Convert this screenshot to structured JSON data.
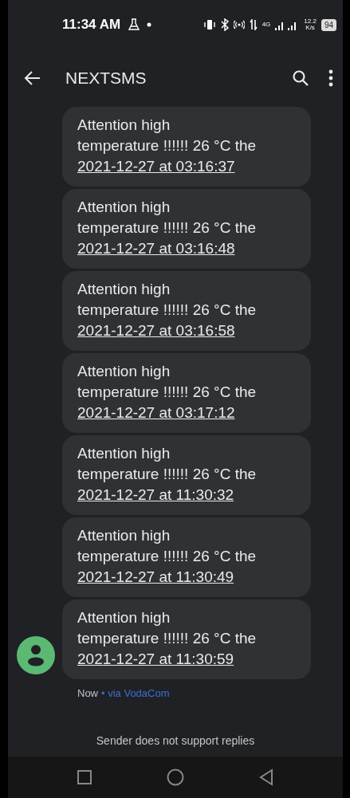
{
  "status_bar": {
    "time": "11:34 AM",
    "network": "4G",
    "speed": "12.2",
    "speed_unit": "K/s",
    "battery": "94"
  },
  "app_bar": {
    "title": "NEXTSMS"
  },
  "messages": [
    {
      "lines": [
        "Attention high",
        "temperature !!!!!! 26 °C the"
      ],
      "link": "2021-12-27 at 03:16:37"
    },
    {
      "lines": [
        "Attention high",
        "temperature !!!!!! 26 °C the"
      ],
      "link": "2021-12-27 at 03:16:48"
    },
    {
      "lines": [
        "Attention high",
        "temperature !!!!!! 26 °C the"
      ],
      "link": "2021-12-27 at 03:16:58"
    },
    {
      "lines": [
        "Attention high",
        "temperature !!!!!! 26 °C the"
      ],
      "link": "2021-12-27 at 03:17:12"
    },
    {
      "lines": [
        "Attention high",
        "temperature !!!!!! 26 °C the"
      ],
      "link": "2021-12-27 at 11:30:32"
    },
    {
      "lines": [
        "Attention high",
        "temperature !!!!!! 26 °C the"
      ],
      "link": "2021-12-27 at 11:30:49"
    },
    {
      "lines": [
        "Attention high",
        "temperature !!!!!! 26 °C the"
      ],
      "link": "2021-12-27 at 11:30:59"
    }
  ],
  "meta": {
    "time": "Now",
    "separator": "•",
    "via": "via VodaCom"
  },
  "footer": "Sender does not support replies"
}
